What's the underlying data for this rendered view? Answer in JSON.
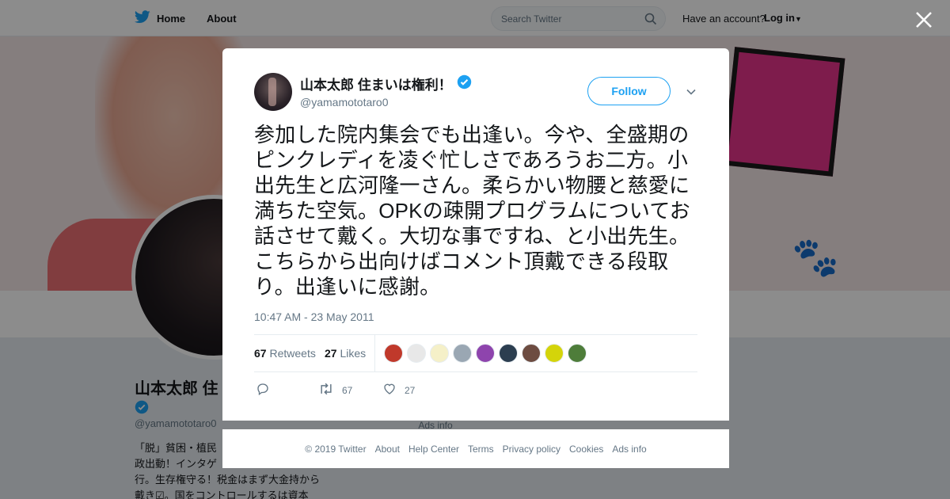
{
  "topbar": {
    "home_label": "Home",
    "about_label": "About",
    "search_placeholder": "Search Twitter",
    "have_account": "Have an account?",
    "login_label": "Log in"
  },
  "profile": {
    "name": "山本太郎 住",
    "handle": "@yamamototaro0",
    "bio": "「脱」貧困・植民\n政出動！インタゲ\n行。生存権守る！税金はまず大金持から\n戴き☑。国をコントロールするは資本",
    "ads": "Ads info"
  },
  "tweet": {
    "author_name": "山本太郎 住まいは権利！",
    "author_handle": "@yamamototaro0",
    "follow_label": "Follow",
    "text": "参加した院内集会でも出逢い。今や、全盛期のピンクレディを凌ぐ忙しさであろうお二方。小出先生と広河隆一さん。柔らかい物腰と慈愛に満ちた空気。OPKの疎開プログラムについてお話させて戴く。大切な事ですね、と小出先生。こちらから出向けばコメント頂戴できる段取り。出逢いに感謝。",
    "timestamp": "10:47 AM - 23 May 2011",
    "retweets_count": "67",
    "retweets_label": "Retweets",
    "likes_count": "27",
    "likes_label": "Likes",
    "action_retweet_count": "67",
    "action_like_count": "27",
    "likers": [
      "#c0392b",
      "#e8e8e8",
      "#f5f0c8",
      "#9aa7b3",
      "#8e44ad",
      "#2c3e50",
      "#6d4c41",
      "#d4d40a",
      "#4e7d3a"
    ]
  },
  "footer": {
    "links": [
      "© 2019 Twitter",
      "About",
      "Help Center",
      "Terms",
      "Privacy policy",
      "Cookies",
      "Ads info"
    ]
  },
  "colors": {
    "accent": "#1da1f2",
    "verified": "#1da1f2"
  }
}
